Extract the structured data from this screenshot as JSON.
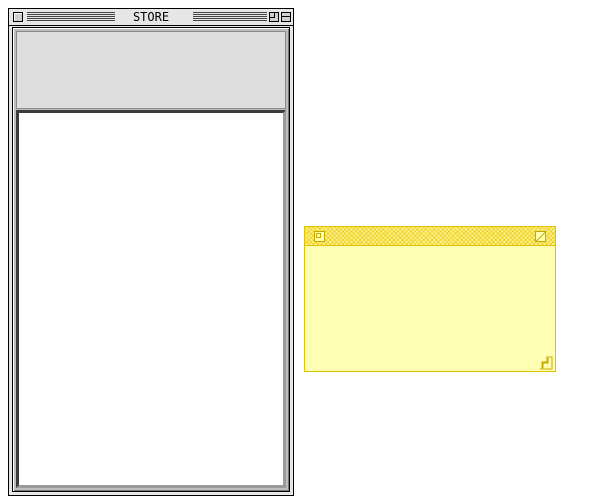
{
  "store_window": {
    "title": "STORE"
  },
  "sticky_note": {
    "text": ""
  },
  "colors": {
    "note_fill": "#ffffb4",
    "note_border": "#e2c300",
    "window_header": "#dedede"
  },
  "icons": {
    "store_close": "close-box-icon",
    "store_zoom": "zoom-box-icon",
    "store_collapse": "collapse-box-icon",
    "note_close": "note-close-icon",
    "note_zoom": "note-zoom-icon",
    "note_resize": "resize-grip-icon"
  }
}
